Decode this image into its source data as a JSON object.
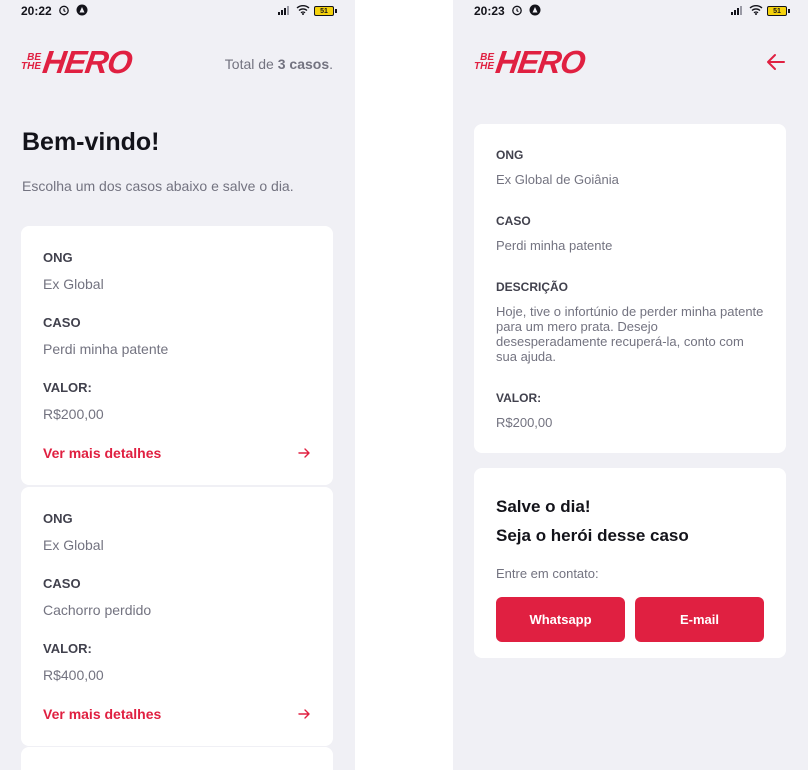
{
  "colors": {
    "accent": "#e02041",
    "background": "#f0f0f5",
    "card": "#ffffff",
    "text_dark": "#13131a",
    "text_label": "#41414d",
    "text_muted": "#737380"
  },
  "list_screen": {
    "status_time": "20:22",
    "battery": "51",
    "logo": {
      "be": "BE",
      "the": "THE",
      "hero": "HERO"
    },
    "total": {
      "prefix": "Total de ",
      "count": "3 casos",
      "suffix": "."
    },
    "title": "Bem-vindo!",
    "subtitle": "Escolha um dos casos abaixo e salve o dia.",
    "labels": {
      "ong": "ONG",
      "caso": "CASO",
      "valor": "VALOR:"
    },
    "details_label": "Ver mais detalhes",
    "incidents": [
      {
        "ong": "Ex Global",
        "caso": "Perdi minha patente",
        "valor": "R$200,00"
      },
      {
        "ong": "Ex Global",
        "caso": "Cachorro perdido",
        "valor": "R$400,00"
      }
    ]
  },
  "detail_screen": {
    "status_time": "20:23",
    "battery": "51",
    "logo": {
      "be": "BE",
      "the": "THE",
      "hero": "HERO"
    },
    "back_icon": "arrow-left-icon",
    "labels": {
      "ong": "ONG",
      "caso": "CASO",
      "descricao": "DESCRIÇÃO",
      "valor": "VALOR:"
    },
    "incident": {
      "ong": "Ex Global de Goiânia",
      "caso": "Perdi minha patente",
      "descricao": "Hoje, tive o infortúnio de perder minha patente para um mero prata. Desejo desesperadamente recuperá-la, conto com sua ajuda.",
      "valor": "R$200,00"
    },
    "contact": {
      "title_line1": "Salve o dia!",
      "title_line2": "Seja o herói desse caso",
      "description": "Entre em contato:",
      "whatsapp_label": "Whatsapp",
      "email_label": "E-mail"
    }
  }
}
